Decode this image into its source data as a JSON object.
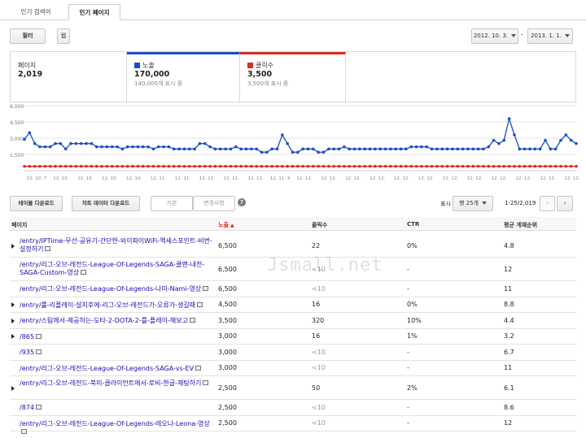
{
  "tabs": [
    {
      "label": "인기 검색어"
    },
    {
      "label": "인기 페이지"
    }
  ],
  "toolbar": {
    "filter_label": "필터",
    "web_label": "웹"
  },
  "date_range": {
    "start": "2012. 10. 3.",
    "separator": "-",
    "end": "2013. 1. 1."
  },
  "summary": {
    "pages": {
      "label": "페이지",
      "value": "2,019"
    },
    "impressions": {
      "label": "노출",
      "value": "170,000",
      "sub": "140,000개 표시 중",
      "color": "#1c4fc4"
    },
    "clicks": {
      "label": "클릭수",
      "value": "3,500",
      "sub": "3,500개 표시 중",
      "color": "#dd2b1f"
    }
  },
  "chart_data": {
    "type": "line",
    "ylim": [
      0,
      6000
    ],
    "yticks": [
      "6,000",
      "4,500",
      "3,000",
      "1,500"
    ],
    "xticks": [
      "12. 10. 7",
      "12. 10.",
      "12. 10.",
      "12. 10.",
      "12. 10.",
      "12. 11.",
      "12. 11.",
      "12. 11.",
      "12. 11.",
      "12. 11.",
      "12. 11. 4",
      "12. 12.",
      "12. 12.",
      "12. 12.",
      "12. 12.",
      "12. 12.",
      "12. 12.",
      "12. 12.",
      "12. 12.",
      "12. 12.",
      "12. 12.",
      "12. 12.",
      "12. 12."
    ],
    "series": [
      {
        "name": "노출",
        "color": "#1c4fc4",
        "values": [
          2900,
          3500,
          2500,
          2200,
          2200,
          2200,
          2500,
          2500,
          2000,
          2500,
          2500,
          2500,
          2500,
          2500,
          2200,
          2200,
          2200,
          2200,
          2200,
          2000,
          2200,
          2200,
          2200,
          2200,
          2200,
          2000,
          2200,
          2200,
          2200,
          2000,
          2000,
          2000,
          2000,
          2000,
          2500,
          2500,
          2200,
          2000,
          2000,
          2000,
          2000,
          2200,
          2000,
          2000,
          2000,
          2000,
          1700,
          1700,
          2000,
          2000,
          3300,
          2500,
          1700,
          1700,
          2000,
          2000,
          2000,
          1700,
          1700,
          2000,
          2000,
          2000,
          2200,
          2000,
          2000,
          2000,
          2000,
          2000,
          2000,
          2000,
          2000,
          2000,
          2000,
          2000,
          2000,
          2200,
          2200,
          2200,
          2200,
          2000,
          2000,
          2000,
          2000,
          2000,
          2000,
          2000,
          2000,
          2000,
          2000,
          2000,
          2200,
          2800,
          2500,
          2800,
          4800,
          3300,
          2000,
          2000,
          2000,
          2000,
          2000,
          2800,
          2000,
          2000,
          2800,
          3300,
          2800,
          2500
        ]
      },
      {
        "name": "클릭수",
        "color": "#dd2b1f",
        "values": [
          400,
          400,
          400,
          400,
          400,
          400,
          400,
          400,
          400,
          400,
          400,
          400,
          400,
          400,
          400,
          400,
          400,
          400,
          400,
          400,
          400,
          400,
          400,
          400,
          400,
          400,
          400,
          400,
          400,
          400,
          400,
          400,
          400,
          400,
          400,
          400,
          400,
          400,
          400,
          400,
          400,
          400,
          400,
          400,
          400,
          400,
          400,
          400,
          400,
          400,
          400,
          400,
          400,
          400,
          400,
          400,
          400,
          400,
          400,
          400,
          400,
          400,
          400,
          400,
          400,
          400,
          400,
          400,
          400,
          400,
          400,
          400,
          400,
          400,
          400,
          400,
          400,
          400,
          400,
          400,
          400,
          400,
          400,
          400,
          400,
          400,
          400,
          400,
          400,
          400,
          400,
          400,
          400,
          400,
          400,
          400,
          400,
          400,
          400,
          400,
          400,
          400,
          400,
          400,
          400,
          400,
          400,
          400
        ]
      }
    ]
  },
  "controls": {
    "download_table": "테이블 다운로드",
    "download_chart": "차트 데이터 다운로드",
    "view_basic": "기본",
    "view_changes": "변경사항",
    "help": "?",
    "show_label": "표시",
    "rows_select": "행 25개",
    "range": "1-25/2,019"
  },
  "table": {
    "headers": {
      "page": "페이지",
      "impressions": "노출",
      "clicks": "클릭수",
      "ctr": "CTR",
      "position": "평균 게재순위"
    },
    "rows": [
      {
        "url": "/entry/IPTime-무선-공유기-간단한-와이파이WiFi-액세스포인트-비번-설정하기",
        "imp": "6,500",
        "clicks": "22",
        "ctr": "0%",
        "pos": "4.8",
        "expandable": true,
        "two": true
      },
      {
        "url": "/entry/리그-오브-레전드-League-Of-Legends-SAGA-클랜-내전-SAGA-Custom-영상",
        "imp": "6,500",
        "clicks": "<10",
        "ctr": "-",
        "pos": "12",
        "expandable": false,
        "two": true
      },
      {
        "url": "/entry/리그-오브-레전드-League-Of-Legends-나미-Nami-영상",
        "imp": "6,500",
        "clicks": "<10",
        "ctr": "-",
        "pos": "11",
        "expandable": false,
        "two": false
      },
      {
        "url": "/entry/롤-리플레이-설치후에-리그-오브-레전드가-오류가-생길때",
        "imp": "4,500",
        "clicks": "16",
        "ctr": "0%",
        "pos": "8.8",
        "expandable": true,
        "two": false
      },
      {
        "url": "/entry/스팀에서-제공하는-도타-2-DOTA-2-를-플레이-해보고",
        "imp": "3,500",
        "clicks": "320",
        "ctr": "10%",
        "pos": "4.4",
        "expandable": true,
        "two": false
      },
      {
        "url": "/865",
        "imp": "3,000",
        "clicks": "16",
        "ctr": "1%",
        "pos": "3.2",
        "expandable": true,
        "two": false
      },
      {
        "url": "/935",
        "imp": "3,000",
        "clicks": "<10",
        "ctr": "-",
        "pos": "6.7",
        "expandable": false,
        "two": false
      },
      {
        "url": "/entry/리그-오브-레전드-League-Of-Legends-SAGA-vs-EV",
        "imp": "3,000",
        "clicks": "<10",
        "ctr": "-",
        "pos": "11",
        "expandable": false,
        "two": false
      },
      {
        "url": "/entry/리그-오브-레전드-북미-클라이언트에서-로비-한글-채팅하기",
        "imp": "2,500",
        "clicks": "50",
        "ctr": "2%",
        "pos": "6.1",
        "expandable": true,
        "two": true
      },
      {
        "url": "/874",
        "imp": "2,500",
        "clicks": "<10",
        "ctr": "-",
        "pos": "8.6",
        "expandable": false,
        "two": false
      },
      {
        "url": "/entry/리그-오브-레전드-League-Of-Legends-레오나-Leona-영상",
        "imp": "2,500",
        "clicks": "<10",
        "ctr": "-",
        "pos": "12",
        "expandable": false,
        "two": false
      }
    ]
  },
  "watermark": "Jsmall.net"
}
